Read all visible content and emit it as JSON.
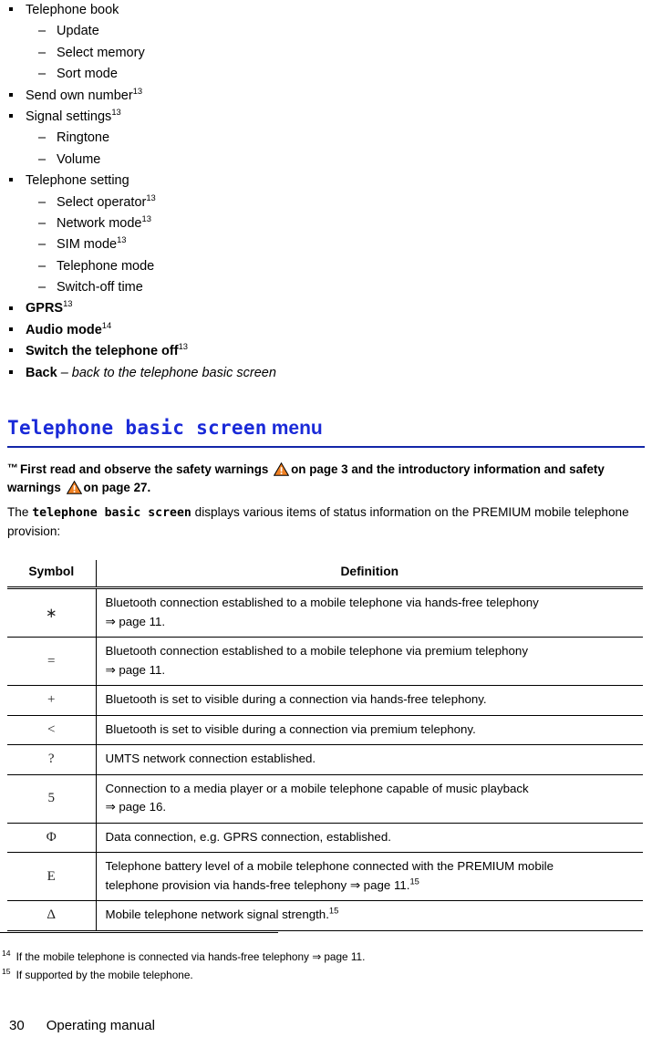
{
  "menu_list": [
    {
      "level": "top",
      "text": "Telephone book",
      "bold": false,
      "italic": false,
      "sup": ""
    },
    {
      "level": "sub",
      "text": "Update",
      "bold": false,
      "italic": false,
      "sup": ""
    },
    {
      "level": "sub",
      "text": "Select memory",
      "bold": false,
      "italic": false,
      "sup": ""
    },
    {
      "level": "sub",
      "text": "Sort mode",
      "bold": false,
      "italic": false,
      "sup": ""
    },
    {
      "level": "top",
      "text": "Send own number",
      "bold": false,
      "italic": false,
      "sup": "13"
    },
    {
      "level": "top",
      "text": "Signal settings",
      "bold": false,
      "italic": false,
      "sup": "13"
    },
    {
      "level": "sub",
      "text": "Ringtone",
      "bold": false,
      "italic": false,
      "sup": ""
    },
    {
      "level": "sub",
      "text": "Volume",
      "bold": false,
      "italic": false,
      "sup": ""
    },
    {
      "level": "top",
      "text": "Telephone setting",
      "bold": false,
      "italic": false,
      "sup": ""
    },
    {
      "level": "sub",
      "text": "Select operator",
      "bold": false,
      "italic": false,
      "sup": "13"
    },
    {
      "level": "sub",
      "text": "Network mode",
      "bold": false,
      "italic": false,
      "sup": "13"
    },
    {
      "level": "sub",
      "text": "SIM mode",
      "bold": false,
      "italic": false,
      "sup": "13"
    },
    {
      "level": "sub",
      "text": "Telephone mode",
      "bold": false,
      "italic": false,
      "sup": ""
    },
    {
      "level": "sub",
      "text": "Switch-off time",
      "bold": false,
      "italic": false,
      "sup": ""
    },
    {
      "level": "top",
      "text": "GPRS",
      "bold": true,
      "italic": false,
      "sup": "13"
    },
    {
      "level": "top",
      "text": "Audio mode",
      "bold": true,
      "italic": false,
      "sup": "14"
    },
    {
      "level": "top",
      "text": "Switch the telephone off",
      "bold": true,
      "italic": false,
      "sup": "13"
    },
    {
      "level": "top",
      "text": "Back",
      "bold": true,
      "italic": false,
      "sup": "",
      "tail_italic": " – back to the telephone basic screen"
    }
  ],
  "list_markers": {
    "top_bullet": "square-bullet",
    "sub_dash": "–"
  },
  "heading": {
    "mono_part": "Telephone basic screen",
    "menu_word": "menu",
    "color": "#1a2ad8",
    "rule_color": "#1226a8"
  },
  "note": {
    "hand_glyph": "™",
    "part1": "First read and observe the safety warnings",
    "part2": "on page 3 and the introductory information and safety warnings",
    "part3": "on page 27.",
    "triangle_color": "#F08022",
    "triangle_outline": "#000000"
  },
  "intro": {
    "before": "The ",
    "mono": "telephone basic screen",
    "after": " displays various items of status information on the PREMIUM mobile telephone provision:"
  },
  "table": {
    "headers": [
      "Symbol",
      "Definition"
    ],
    "rows": [
      {
        "symbol": "∗",
        "line1": "Bluetooth connection established to a mobile telephone via hands-free telephony",
        "line2": "⇒ page 11.",
        "sup": ""
      },
      {
        "symbol": "=",
        "line1": "Bluetooth connection established to a mobile telephone via premium telephony",
        "line2": "⇒ page 11.",
        "sup": ""
      },
      {
        "symbol": "+",
        "line1": "Bluetooth is set to visible during a connection via hands-free telephony.",
        "line2": "",
        "sup": ""
      },
      {
        "symbol": "<",
        "line1": "Bluetooth is set to visible during a connection via premium telephony.",
        "line2": "",
        "sup": ""
      },
      {
        "symbol": "?",
        "line1": "UMTS network connection established.",
        "line2": "",
        "sup": ""
      },
      {
        "symbol": "5",
        "line1": "Connection to a media player or a mobile telephone capable of music playback",
        "line2": "⇒ page 16.",
        "sup": ""
      },
      {
        "symbol": "Φ",
        "line1": "Data connection, e.g. GPRS connection, established.",
        "line2": "",
        "sup": ""
      },
      {
        "symbol": "E",
        "line1": "Telephone battery level of a mobile telephone connected with the PREMIUM mobile",
        "line2": "telephone provision via hands-free telephony ⇒ page 11.",
        "sup": "15"
      },
      {
        "symbol": "Δ",
        "line1": "Mobile telephone network signal strength.",
        "line2": "",
        "sup": "15"
      }
    ]
  },
  "footnotes": [
    {
      "num": "14",
      "text": "If the mobile telephone is connected via hands-free telephony ⇒ page 11."
    },
    {
      "num": "15",
      "text": "If supported by the mobile telephone."
    }
  ],
  "page_footer": {
    "page_number": "30",
    "label": "Operating manual"
  }
}
